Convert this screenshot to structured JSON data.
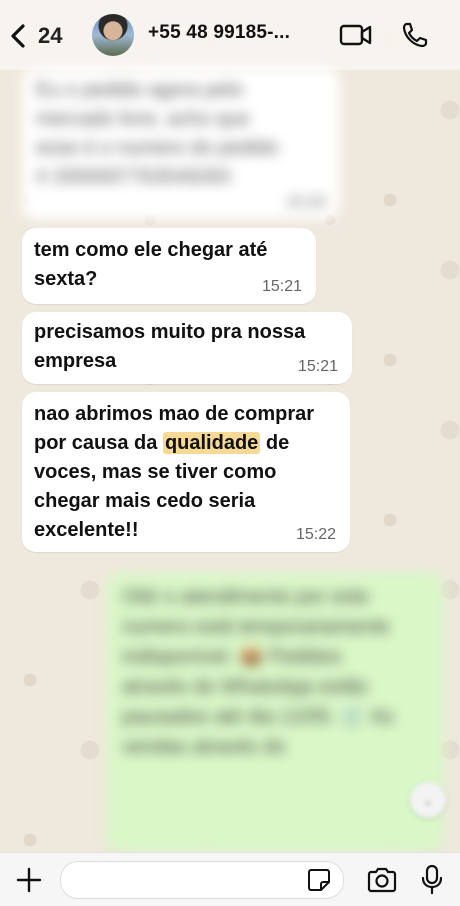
{
  "header": {
    "back_count": "24",
    "contact_name": "+55 48 99185-..."
  },
  "messages": [
    {
      "text": "Eu o pedido agora pelo mercado livre, acho que esse é o numero do pedido # 2000007763549283",
      "time": "15:20",
      "blurred": true
    },
    {
      "text": "tem como ele chegar até sexta?",
      "time": "15:21"
    },
    {
      "text": "precisamos muito pra nossa empresa",
      "time": "15:21"
    },
    {
      "text_before": "nao abrimos mao de comprar por causa da ",
      "highlight": "qualidade",
      "text_after": " de voces, mas se tiver como chegar mais cedo seria excelente!!",
      "time": "15:22"
    }
  ],
  "outgoing": {
    "text": "Olá! o atendimento por este numero está temporariamente indisponível. 📦 Pedidos através do WhatsApp estão pausados até dia 12/05. 🛒 As vendas através do",
    "blurred": true
  },
  "colors": {
    "highlight": "#f7d996",
    "outgoing_bubble": "#d9f7c7",
    "incoming_bubble": "#ffffff"
  },
  "icons": [
    "chevron-left-icon",
    "video-call-icon",
    "phone-icon",
    "plus-icon",
    "sticker-icon",
    "camera-icon",
    "mic-icon",
    "scroll-down-icon"
  ]
}
